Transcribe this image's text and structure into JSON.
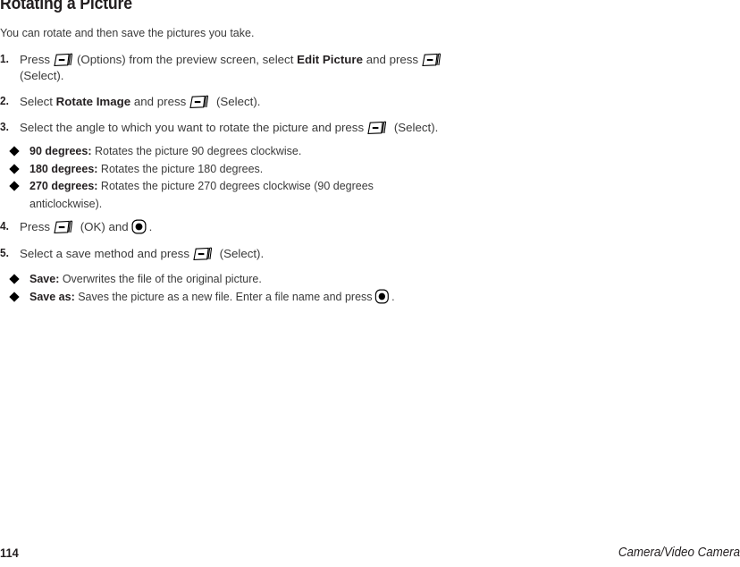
{
  "document": {
    "heading": "Rotating a Picture",
    "intro": "You can rotate and then save the pictures you take."
  },
  "icons": {
    "softkey": "softkey-minus-icon",
    "centerkey": "center-select-key-icon"
  },
  "steps": [
    {
      "number": "1.",
      "pre": "Press",
      "icon": "softkey",
      "mid": "(Options) from the preview screen, select",
      "bold": "Edit Picture",
      "mid2": "and press",
      "icon2": "softkey",
      "post": "(Select)."
    },
    {
      "number": "2.",
      "pre": "Select",
      "bold": "Rotate Image",
      "mid": "and press",
      "icon": "softkey",
      "post": "(Select)."
    },
    {
      "number": "3.",
      "pre": "Select the angle to which you want to rotate the picture and press",
      "icon": "softkey",
      "post": "(Select)."
    },
    {
      "number": "4.",
      "pre": "Press",
      "icon": "softkey",
      "mid": "(OK) and",
      "icon2": "centerkey",
      "post": "."
    },
    {
      "number": "5.",
      "pre": "Select a save method and press",
      "icon": "softkey",
      "post": "(Select)."
    }
  ],
  "angle_bullets": [
    {
      "term": "90 degrees:",
      "text": "Rotates the picture 90 degrees clockwise."
    },
    {
      "term": "180 degrees:",
      "text": "Rotates the picture 180 degrees."
    },
    {
      "term": "270 degrees:",
      "text": "Rotates the picture 270 degrees clockwise (90 degrees",
      "text_line2": "anticlockwise)."
    }
  ],
  "save_bullets": [
    {
      "term": "Save:",
      "text": "Overwrites the file of the original picture."
    },
    {
      "term": "Save as:",
      "text": "Saves the picture as a new file. Enter a file name and press",
      "icon": "centerkey",
      "post": "."
    }
  ],
  "footer": {
    "page_number": "114",
    "running_head": "Camera/Video Camera"
  }
}
